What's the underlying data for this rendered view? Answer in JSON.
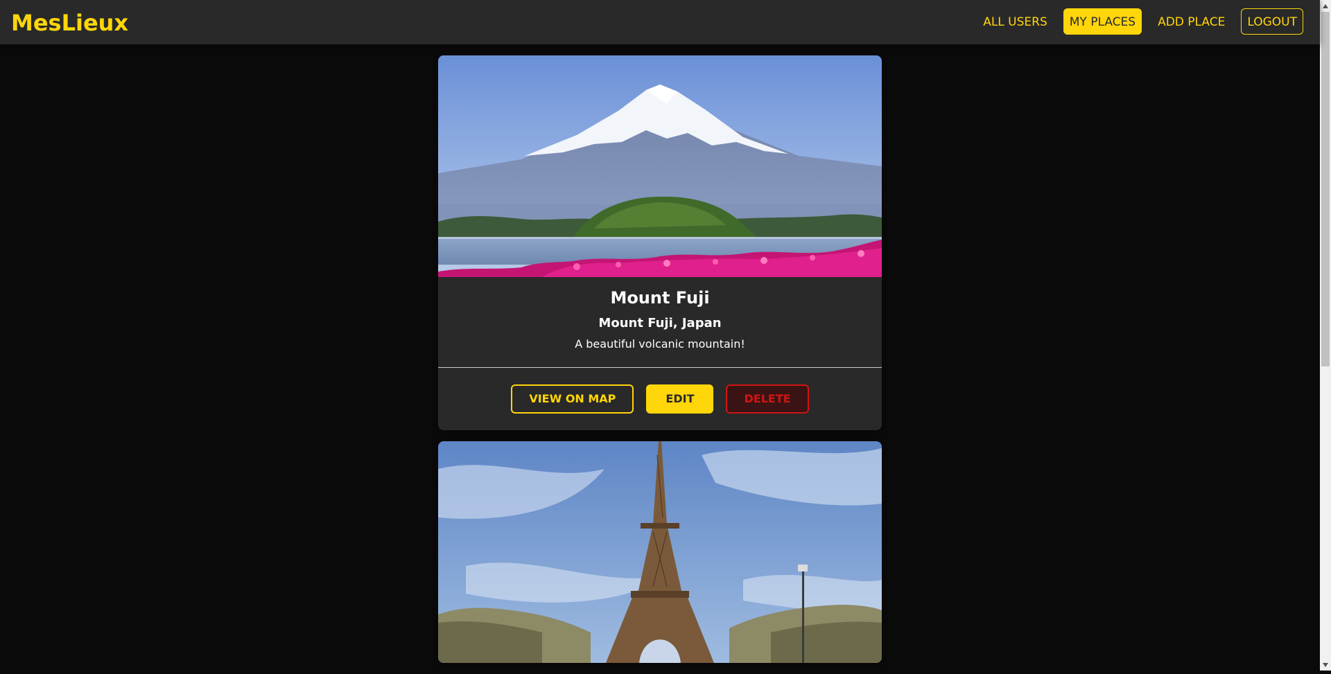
{
  "header": {
    "brand": "MesLieux",
    "nav": [
      {
        "label": "ALL USERS"
      },
      {
        "label": "MY PLACES"
      },
      {
        "label": "ADD PLACE"
      },
      {
        "label": "LOGOUT"
      }
    ]
  },
  "places": [
    {
      "title": "Mount Fuji",
      "address": "Mount Fuji, Japan",
      "description": "A beautiful volcanic mountain!",
      "actions": {
        "view_on_map": "VIEW ON MAP",
        "edit": "EDIT",
        "delete": "DELETE"
      }
    }
  ],
  "colors": {
    "accent": "#ffd60a",
    "surface": "#292929",
    "background": "#0a0a0a",
    "danger": "#d01414"
  }
}
